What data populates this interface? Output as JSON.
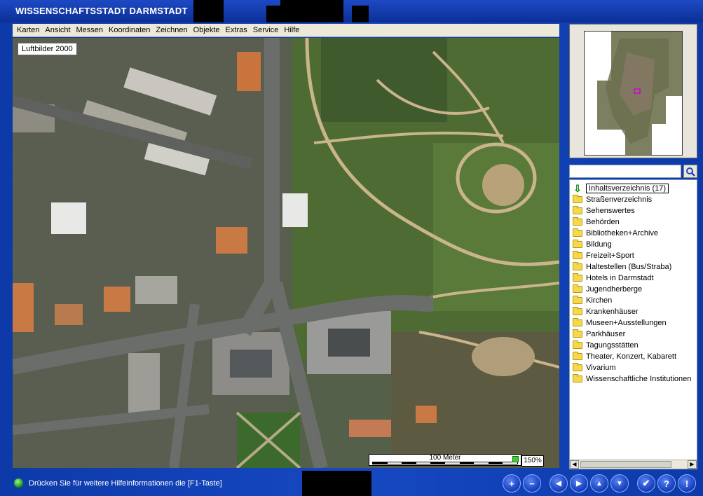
{
  "window": {
    "title": "WISSENSCHAFTSSTADT DARMSTADT"
  },
  "menu": [
    "Karten",
    "Ansicht",
    "Messen",
    "Koordinaten",
    "Zeichnen",
    "Objekte",
    "Extras",
    "Service",
    "Hilfe"
  ],
  "map": {
    "layer_label": "Luftbilder 2000",
    "scale_label": "100 Meter",
    "zoom_level": "150%"
  },
  "search": {
    "value": "",
    "placeholder": ""
  },
  "tree": {
    "root": "Inhaltsverzeichnis (17)",
    "items": [
      "Straßenverzeichnis",
      "Sehenswertes",
      "Behörden",
      "Bibliotheken+Archive",
      "Bildung",
      "Freizeit+Sport",
      "Haltestellen (Bus/Straba)",
      "Hotels in Darmstadt",
      "Jugendherberge",
      "Kirchen",
      "Krankenhäuser",
      "Museen+Ausstellungen",
      "Parkhäuser",
      "Tagungsstätten",
      "Theater, Konzert, Kabarett",
      "Vivarium",
      "Wissenschaftliche Institutionen"
    ]
  },
  "status": {
    "message": "Drücken Sie für weitere Hilfeinformationen die [F1-Taste]"
  },
  "toolbar": {
    "zoom_in": "+",
    "zoom_out": "−",
    "left": "◀",
    "right": "▶",
    "up": "▲",
    "down": "▼",
    "ok": "✔",
    "help": "?",
    "info": "!"
  },
  "colors": {
    "frame": "#0d3aa8",
    "menu_bg": "#ece9d8",
    "led": "#1fa31a"
  }
}
